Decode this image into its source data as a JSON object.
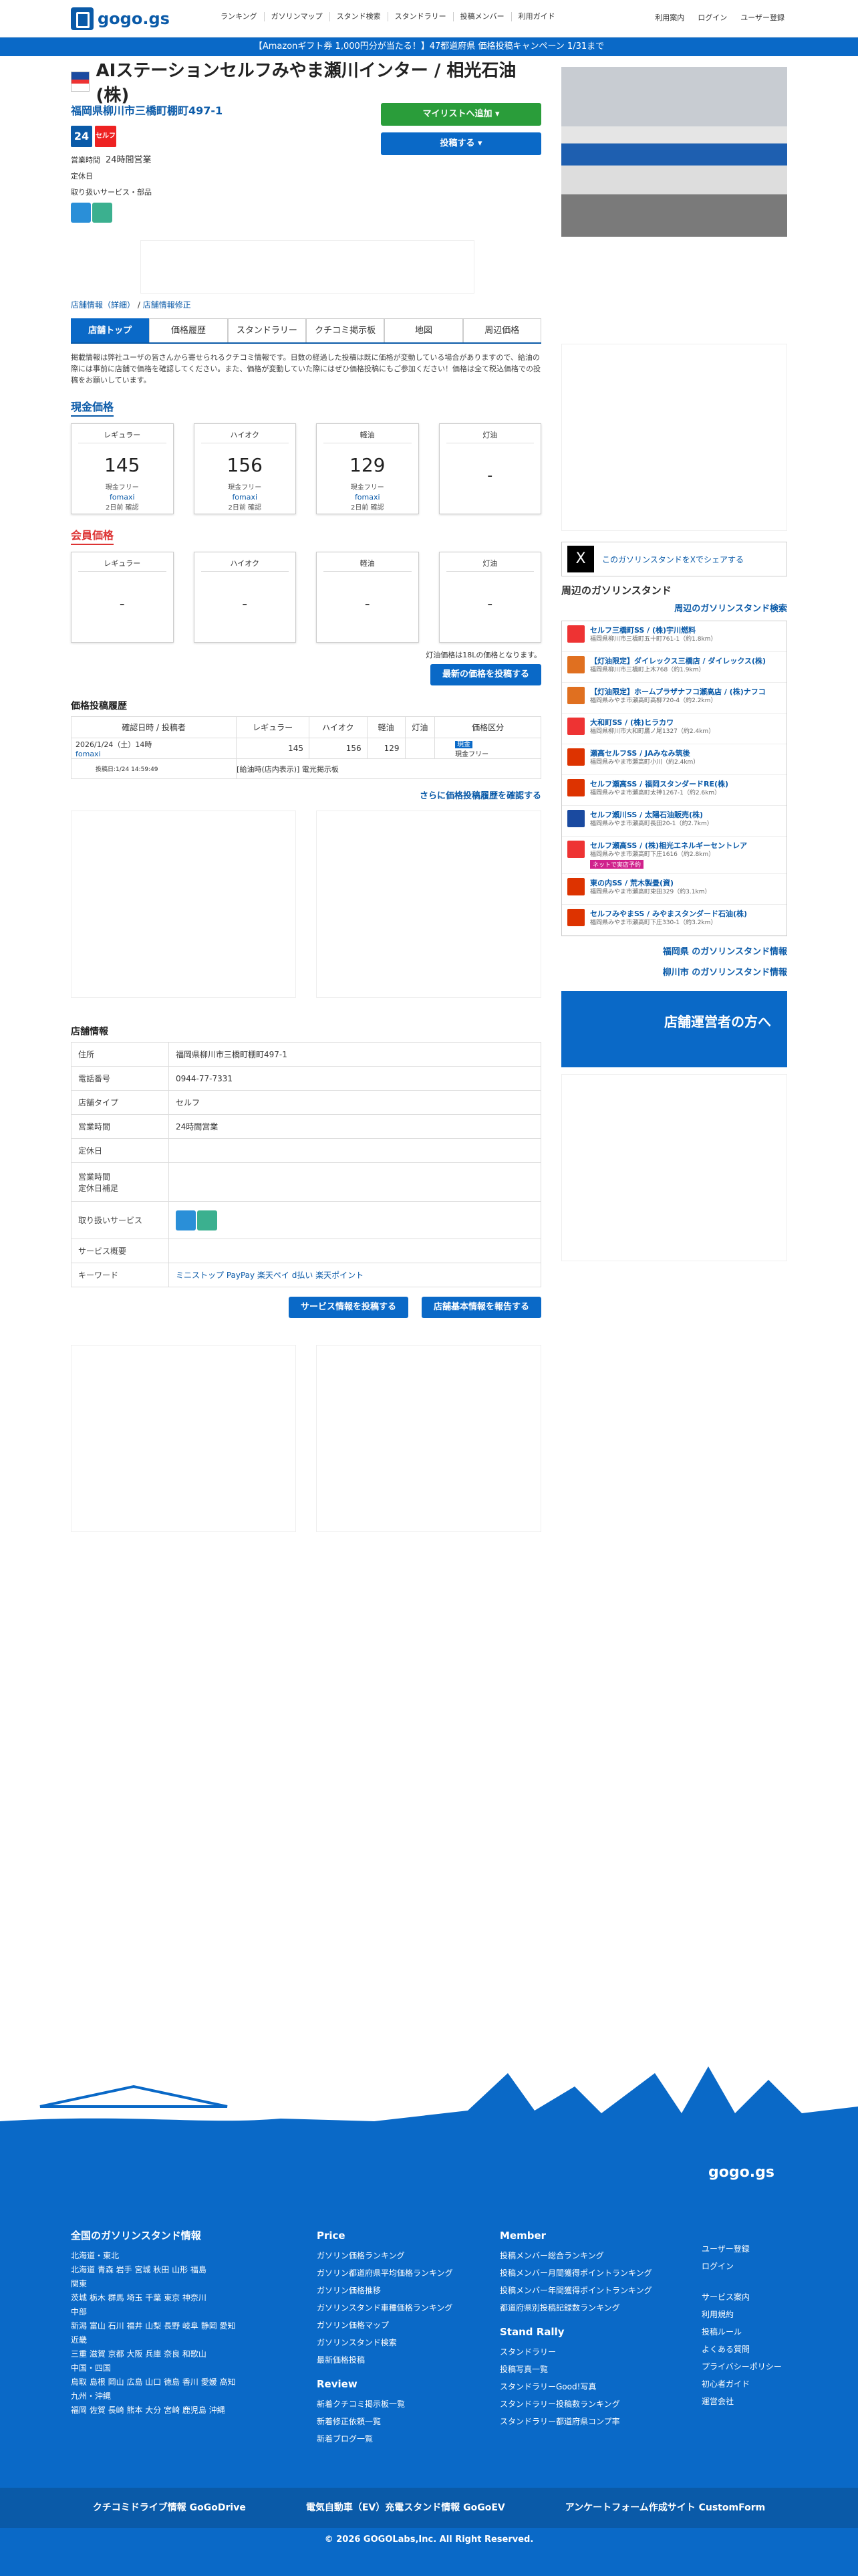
{
  "header": {
    "logo": "gogo.gs",
    "nav": [
      "ランキング",
      "ガソリンマップ",
      "スタンド検索",
      "スタンドラリー",
      "投稿メンバー",
      "利用ガイド"
    ],
    "user_nav": [
      "利用案内",
      "ログイン",
      "ユーザー登録"
    ]
  },
  "banner": "【Amazonギフト券 1,000円分が当たる！】47都道府県 価格投稿キャンペーン 1/31まで",
  "station": {
    "title": "AIステーションセルフみやま瀬川インター / 相光石油(株)",
    "address": "福岡県柳川市三橋町棚町497-1",
    "badge24": "24",
    "badge_self": "セルフ",
    "hours_label": "営業時間",
    "hours": "24時間営業",
    "closed_label": "定休日",
    "services_label": "取り扱いサービス・部品"
  },
  "actions": {
    "mylist": "マイリストへ追加 ▾",
    "post": "投稿する ▾"
  },
  "breadcrumb": [
    "店舗情報（詳細）",
    "店舗情報修正"
  ],
  "tabs": [
    "店舗トップ",
    "価格履歴",
    "スタンドラリー",
    "クチコミ掲示板",
    "地図",
    "周辺価格"
  ],
  "notice": "掲載情報は弊社ユーザの皆さんから寄せられるクチコミ情報です。日数の経過した投稿は既に価格が変動している場合がありますので、給油の際には事前に店舗で価格を確認してください。また、価格が変動していた際にはぜひ価格投稿にもご参加ください！価格は全て税込価格での投稿をお願いしています。",
  "current_label": "現金価格",
  "member_label": "会員価格",
  "prices": [
    {
      "label": "レギュラー",
      "value": "145",
      "sub": "現金フリー",
      "who": "fomaxi",
      "when": "2日前 確認"
    },
    {
      "label": "ハイオク",
      "value": "156",
      "sub": "現金フリー",
      "who": "fomaxi",
      "when": "2日前 確認"
    },
    {
      "label": "軽油",
      "value": "129",
      "sub": "現金フリー",
      "who": "fomaxi",
      "when": "2日前 確認"
    },
    {
      "label": "灯油",
      "value": "-"
    }
  ],
  "member_prices": [
    {
      "label": "レギュラー",
      "value": "-"
    },
    {
      "label": "ハイオク",
      "value": "-"
    },
    {
      "label": "軽油",
      "value": "-"
    },
    {
      "label": "灯油",
      "value": "-"
    }
  ],
  "kerosene_note": "灯油価格は18Lの価格となります。",
  "post_latest": "最新の価格を投稿する",
  "history": {
    "title": "価格投稿履歴",
    "cols": [
      "確認日時 / 投稿者",
      "レギュラー",
      "ハイオク",
      "軽油",
      "灯油",
      "価格区分"
    ],
    "date": "2026/1/24（土）14時",
    "who": "fomaxi",
    "r": "145",
    "h": "156",
    "d": "129",
    "type": "現金",
    "type2": "現金フリー",
    "posted": "投稿日:1/24 14:59:49",
    "note": "[給油時(店内表示)] 電光掲示板"
  },
  "more_history": "さらに価格投稿履歴を確認する",
  "store": {
    "title": "店舗情報",
    "rows": [
      [
        "住所",
        "福岡県柳川市三橋町棚町497-1"
      ],
      [
        "電話番号",
        "0944-77-7331"
      ],
      [
        "店舗タイプ",
        "セルフ"
      ],
      [
        "営業時間",
        "24時間営業"
      ],
      [
        "定休日",
        ""
      ],
      [
        "営業時間\n定休日補足",
        ""
      ],
      [
        "取り扱いサービス",
        ""
      ],
      [
        "サービス概要",
        ""
      ],
      [
        "キーワード",
        "ミニストップ PayPay 楽天ペイ d払い 楽天ポイント"
      ]
    ]
  },
  "post_service": "サービス情報を投稿する",
  "report_basic": "店舗基本情報を報告する",
  "side": {
    "share": "このガソリンスタンドをXでシェアする",
    "near_title": "周辺のガソリンスタンド",
    "near_search": "周辺のガソリンスタンド検索",
    "near": [
      {
        "n": "セルフ三橋町SS / (株)宇川燃料",
        "a": "福岡県柳川市三橋町五十町761-1（約1.8km）",
        "c": "#e33"
      },
      {
        "n": "【灯油限定】ダイレックス三橋店 / ダイレックス(株)",
        "a": "福岡県柳川市三橋町上木768（約1.9km）",
        "c": "#e07020"
      },
      {
        "n": "【灯油限定】ホームプラザナフコ瀬高店 / (株)ナフコ",
        "a": "福岡県みやま市瀬高町高柳720-4（約2.2km）",
        "c": "#e07020"
      },
      {
        "n": "大和町SS / (株)ヒラカワ",
        "a": "福岡県柳川市大和町鷹ノ尾1327（約2.4km）",
        "c": "#e33"
      },
      {
        "n": "瀬高セルフSS / JAみなみ筑後",
        "a": "福岡県みやま市瀬高町小川（約2.4km）",
        "c": "#d30"
      },
      {
        "n": "セルフ瀬高SS / 福岡スタンダードRE(株)",
        "a": "福岡県みやま市瀬高町太神1267-1（約2.6km）",
        "c": "#d30"
      },
      {
        "n": "セルフ瀬川SS / 太陽石油販売(株)",
        "a": "福岡県みやま市瀬高町長田20-1（約2.7km）",
        "c": "#1a4aa0"
      },
      {
        "n": "セルフ瀬高SS / (株)相光エネルギーセントレア",
        "a": "福岡県みやま市瀬高町下庄1616（約2.8km）",
        "c": "#e33"
      },
      {
        "n": "東の内SS / 荒木製畳(資)",
        "a": "福岡県みやま市瀬高町東田329（約3.1km）",
        "c": "#d30"
      },
      {
        "n": "セルフみやまSS / みやまスタンダード石油(株)",
        "a": "福岡県みやま市瀬高町下庄330-1（約3.2km）",
        "c": "#d30"
      }
    ],
    "net_badge": "ネットで実店予約",
    "pref_link": "福岡県 のガソリンスタンド情報",
    "city_link": "柳川市 のガソリンスタンド情報",
    "owner_banner": "店舗運営者の方へ"
  },
  "footer": {
    "logo": "gogo.gs",
    "regions_title": "全国のガソリンスタンド情報",
    "regions": [
      [
        "北海道・東北",
        "北海道 青森 岩手 宮城 秋田 山形 福島"
      ],
      [
        "関東",
        "茨城 栃木 群馬 埼玉 千葉 東京 神奈川"
      ],
      [
        "中部",
        "新潟 富山 石川 福井 山梨 長野 岐阜 静岡 愛知"
      ],
      [
        "近畿",
        "三重 滋賀 京都 大阪 兵庫 奈良 和歌山"
      ],
      [
        "中国・四国",
        "鳥取 島根 岡山 広島 山口 徳島 香川 愛媛 高知"
      ],
      [
        "九州・沖縄",
        "福岡 佐賀 長崎 熊本 大分 宮崎 鹿児島 沖縄"
      ]
    ],
    "price_title": "Price",
    "price": [
      "ガソリン価格ランキング",
      "ガソリン都道府県平均価格ランキング",
      "ガソリン価格推移",
      "ガソリンスタンド車種価格ランキング",
      "ガソリン価格マップ",
      "ガソリンスタンド検索",
      "最新価格投稿"
    ],
    "review_title": "Review",
    "review": [
      "新着クチコミ掲示板一覧",
      "新着修正依頼一覧",
      "新着ブログ一覧"
    ],
    "member_title": "Member",
    "member": [
      "投稿メンバー総合ランキング",
      "投稿メンバー月間獲得ポイントランキング",
      "投稿メンバー年間獲得ポイントランキング",
      "都道府県別投稿記録数ランキング"
    ],
    "rally_title": "Stand Rally",
    "rally": [
      "スタンドラリー",
      "投稿写真一覧",
      "スタンドラリーGood!写真",
      "スタンドラリー投稿数ランキング",
      "スタンドラリー都道府県コンプ率"
    ],
    "links": [
      "ユーザー登録",
      "ログイン",
      "サービス案内",
      "利用規約",
      "投稿ルール",
      "よくある質問",
      "プライバシーポリシー",
      "初心者ガイド",
      "運営会社"
    ],
    "bottom": [
      "クチコミドライブ情報 GoGoDrive",
      "電気自動車（EV）充電スタンド情報 GoGoEV",
      "アンケートフォーム作成サイト CustomForm"
    ],
    "copyright": "© 2026 GOGOLabs,Inc. All Right Reserved."
  }
}
